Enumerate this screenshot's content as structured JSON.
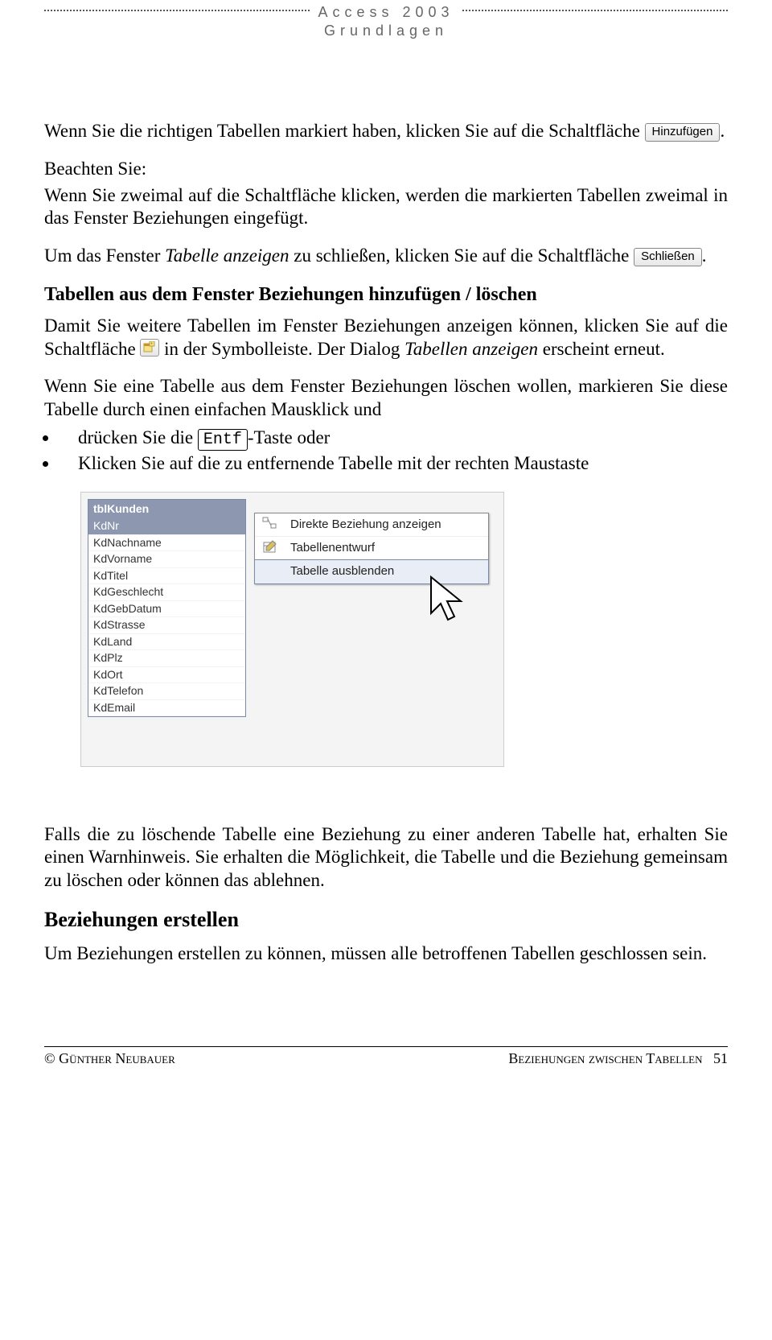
{
  "header": {
    "line1": "Access 2003",
    "line2": "Grundlagen"
  },
  "content": {
    "p1a": "Wenn Sie die richtigen Tabellen markiert haben, klicken Sie auf die Schaltfläche ",
    "p1b": ".",
    "btn_add": "Hinzufügen",
    "note_label": "Beachten Sie:",
    "p2": "Wenn Sie zweimal auf die Schaltfläche klicken, werden die markierten Tabellen zweimal in das Fenster Beziehungen eingefügt.",
    "p3a": "Um das Fenster ",
    "p3b": "Tabelle anzeigen",
    "p3c": " zu schließen, klicken Sie auf die Schaltfläche ",
    "p3d": ".",
    "btn_close": "Schließen",
    "h1": "Tabellen aus dem Fenster Beziehungen hinzufügen / löschen",
    "p4a": "Damit Sie weitere Tabellen im Fenster Beziehungen anzeigen können, klicken Sie auf die Schaltfläche ",
    "p4b": " in der Symbolleiste. Der Dialog ",
    "p4c": "Tabellen anzeigen",
    "p4d": " erscheint erneut.",
    "p5": "Wenn Sie eine Tabelle aus dem Fenster Beziehungen löschen wollen, markieren Sie diese Tabelle durch einen einfachen Mausklick und",
    "bul1a": "drücken Sie die ",
    "bul1_key": "Entf",
    "bul1b": "-Taste oder",
    "bul2": "Klicken Sie auf die zu entfernende Tabelle mit der rechten Maustaste",
    "p6": "Falls die zu löschende Tabelle eine Beziehung zu einer anderen Tabelle hat, erhalten Sie einen Warnhinweis. Sie erhalten die Möglichkeit, die Tabelle und die Beziehung gemeinsam zu löschen oder können das ablehnen.",
    "h2": "Beziehungen erstellen",
    "p7": "Um Beziehungen erstellen zu können, müssen alle betroffenen Tabellen geschlossen sein."
  },
  "mock": {
    "table_title": "tblKunden",
    "fields": [
      "KdNr",
      "KdNachname",
      "KdVorname",
      "KdTitel",
      "KdGeschlecht",
      "KdGebDatum",
      "KdStrasse",
      "KdLand",
      "KdPlz",
      "KdOrt",
      "KdTelefon",
      "KdEmail"
    ],
    "menu": [
      "Direkte Beziehung anzeigen",
      "Tabellenentwurf",
      "Tabelle ausblenden"
    ]
  },
  "footer": {
    "left": "© Günther Neubauer",
    "right_text": "Beziehungen zwischen Tabellen",
    "page": "51"
  }
}
